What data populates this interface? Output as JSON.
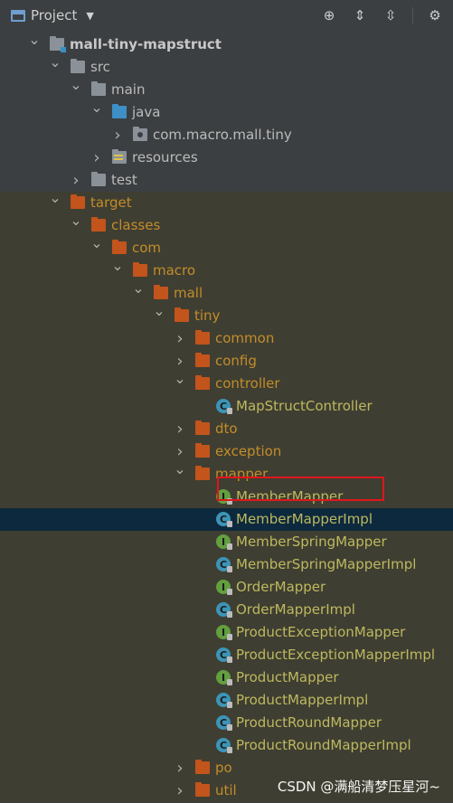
{
  "toolbar": {
    "title": "Project",
    "icons": [
      "locate-icon",
      "expand-all-icon",
      "collapse-all-icon",
      "gear-icon"
    ]
  },
  "tree": [
    {
      "label": "mall-tiny-mapstruct",
      "icon": "module-folder-icon",
      "arrow": "down",
      "indent": 0,
      "bold": true
    },
    {
      "label": "src",
      "icon": "folder-icon",
      "arrow": "down",
      "indent": 1
    },
    {
      "label": "main",
      "icon": "folder-icon",
      "arrow": "down",
      "indent": 2
    },
    {
      "label": "java",
      "icon": "source-folder-icon",
      "arrow": "down",
      "indent": 3
    },
    {
      "label": "com.macro.mall.tiny",
      "icon": "package-icon",
      "arrow": "right",
      "indent": 4
    },
    {
      "label": "resources",
      "icon": "resources-folder-icon",
      "arrow": "right",
      "indent": 3
    },
    {
      "label": "test",
      "icon": "folder-icon",
      "arrow": "right",
      "indent": 2
    },
    {
      "label": "target",
      "icon": "excluded-folder-icon",
      "arrow": "down",
      "indent": 1,
      "target": true
    },
    {
      "label": "classes",
      "icon": "excluded-folder-icon",
      "arrow": "down",
      "indent": 2,
      "target": true
    },
    {
      "label": "com",
      "icon": "excluded-folder-icon",
      "arrow": "down",
      "indent": 3,
      "target": true
    },
    {
      "label": "macro",
      "icon": "excluded-folder-icon",
      "arrow": "down",
      "indent": 4,
      "target": true
    },
    {
      "label": "mall",
      "icon": "excluded-folder-icon",
      "arrow": "down",
      "indent": 5,
      "target": true
    },
    {
      "label": "tiny",
      "icon": "excluded-folder-icon",
      "arrow": "down",
      "indent": 6,
      "target": true
    },
    {
      "label": "common",
      "icon": "excluded-folder-icon",
      "arrow": "right",
      "indent": 7,
      "target": true
    },
    {
      "label": "config",
      "icon": "excluded-folder-icon",
      "arrow": "right",
      "indent": 7,
      "target": true
    },
    {
      "label": "controller",
      "icon": "excluded-folder-icon",
      "arrow": "down",
      "indent": 7,
      "target": true
    },
    {
      "label": "MapStructController",
      "icon": "class-icon",
      "arrow": "none",
      "indent": 8,
      "target": true,
      "kind": "C"
    },
    {
      "label": "dto",
      "icon": "excluded-folder-icon",
      "arrow": "right",
      "indent": 7,
      "target": true
    },
    {
      "label": "exception",
      "icon": "excluded-folder-icon",
      "arrow": "right",
      "indent": 7,
      "target": true
    },
    {
      "label": "mapper",
      "icon": "excluded-folder-icon",
      "arrow": "down",
      "indent": 7,
      "target": true
    },
    {
      "label": "MemberMapper",
      "icon": "interface-icon",
      "arrow": "none",
      "indent": 8,
      "target": true,
      "kind": "I"
    },
    {
      "label": "MemberMapperImpl",
      "icon": "class-icon",
      "arrow": "none",
      "indent": 8,
      "target": true,
      "kind": "C",
      "selected": true
    },
    {
      "label": "MemberSpringMapper",
      "icon": "interface-icon",
      "arrow": "none",
      "indent": 8,
      "target": true,
      "kind": "I"
    },
    {
      "label": "MemberSpringMapperImpl",
      "icon": "class-icon",
      "arrow": "none",
      "indent": 8,
      "target": true,
      "kind": "C"
    },
    {
      "label": "OrderMapper",
      "icon": "interface-icon",
      "arrow": "none",
      "indent": 8,
      "target": true,
      "kind": "I"
    },
    {
      "label": "OrderMapperImpl",
      "icon": "class-icon",
      "arrow": "none",
      "indent": 8,
      "target": true,
      "kind": "C"
    },
    {
      "label": "ProductExceptionMapper",
      "icon": "interface-icon",
      "arrow": "none",
      "indent": 8,
      "target": true,
      "kind": "I"
    },
    {
      "label": "ProductExceptionMapperImpl",
      "icon": "class-icon",
      "arrow": "none",
      "indent": 8,
      "target": true,
      "kind": "C"
    },
    {
      "label": "ProductMapper",
      "icon": "interface-icon",
      "arrow": "none",
      "indent": 8,
      "target": true,
      "kind": "I"
    },
    {
      "label": "ProductMapperImpl",
      "icon": "class-icon",
      "arrow": "none",
      "indent": 8,
      "target": true,
      "kind": "C"
    },
    {
      "label": "ProductRoundMapper",
      "icon": "class-icon",
      "arrow": "none",
      "indent": 8,
      "target": true,
      "kind": "C"
    },
    {
      "label": "ProductRoundMapperImpl",
      "icon": "class-icon",
      "arrow": "none",
      "indent": 8,
      "target": true,
      "kind": "C"
    },
    {
      "label": "po",
      "icon": "excluded-folder-icon",
      "arrow": "right",
      "indent": 7,
      "target": true
    },
    {
      "label": "util",
      "icon": "excluded-folder-icon",
      "arrow": "right",
      "indent": 7,
      "target": true
    }
  ],
  "watermark": "CSDN @满船清梦压星河~",
  "colors": {
    "background": "#3c3f41",
    "target_background": "#3f3e32",
    "selected_background": "#0d293e",
    "highlight_border": "#e0161b",
    "target_text": "#c28d2a",
    "class_text": "#bdb95f"
  }
}
